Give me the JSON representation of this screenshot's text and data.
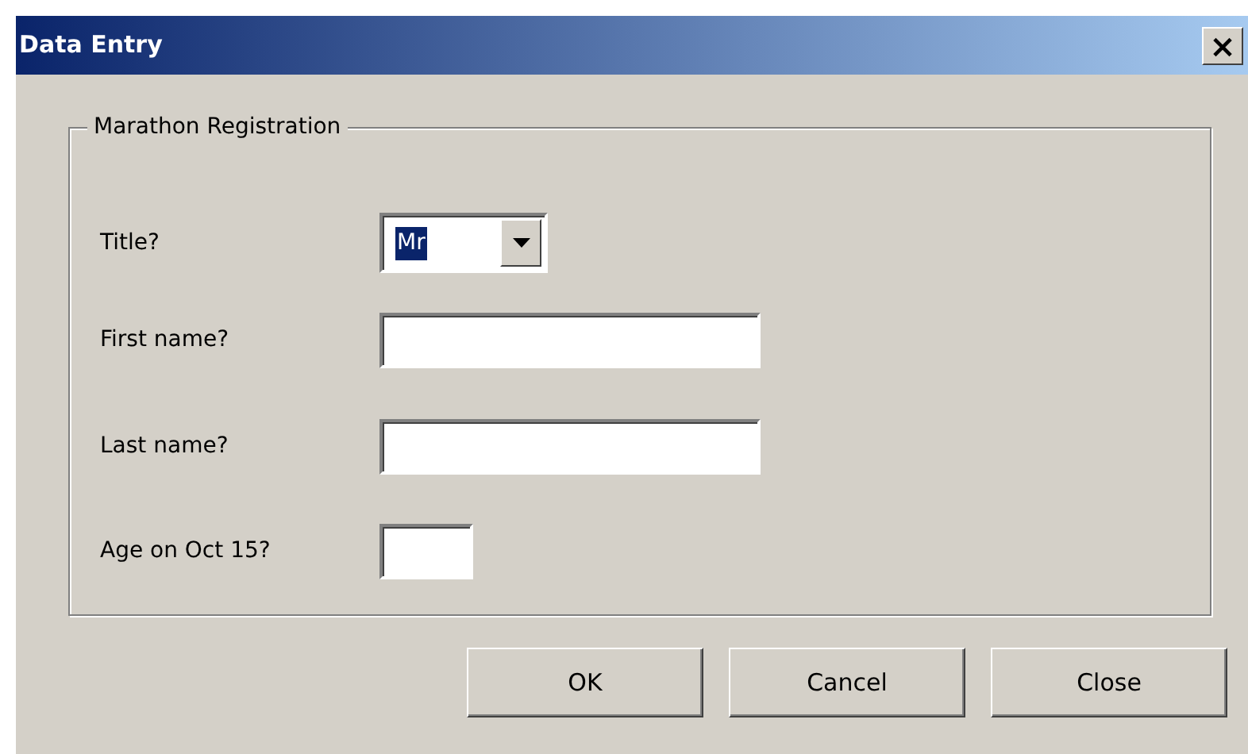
{
  "window": {
    "title": "Data Entry",
    "close_button": "×"
  },
  "group": {
    "legend": "Marathon Registration",
    "fields": [
      {
        "kind": "combo",
        "label": "Title?",
        "value": "Mr",
        "highlighted": true
      },
      {
        "kind": "text",
        "label": "First name?"
      },
      {
        "kind": "text",
        "label": "Last name?"
      },
      {
        "kind": "short_text",
        "label": "Age on Oct 15?"
      }
    ]
  },
  "buttons": [
    "OK",
    "Cancel",
    "Close"
  ]
}
